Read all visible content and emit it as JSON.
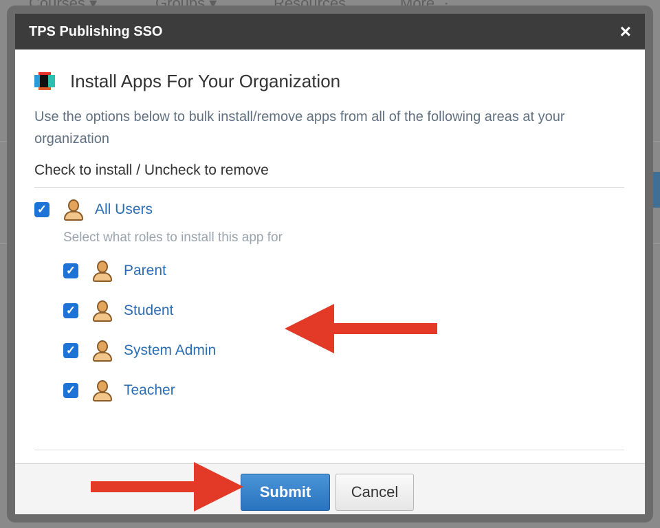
{
  "background": {
    "nav_items": [
      "Courses ▾",
      "Groups ▾",
      "Resources",
      "More ⋮"
    ]
  },
  "dialog": {
    "title": "TPS Publishing SSO",
    "close_glyph": "×",
    "heading": "Install Apps For Your Organization",
    "description": "Use the options below to bulk install/remove apps from all of the following areas at your organization",
    "check_instruction": "Check to install / Uncheck to remove",
    "all_users": {
      "label": "All Users",
      "checked": true
    },
    "roles_hint": "Select what roles to install this app for",
    "roles": [
      {
        "label": "Parent",
        "checked": true
      },
      {
        "label": "Student",
        "checked": true
      },
      {
        "label": "System Admin",
        "checked": true
      },
      {
        "label": "Teacher",
        "checked": true
      }
    ],
    "buttons": {
      "submit": "Submit",
      "cancel": "Cancel"
    }
  },
  "colors": {
    "title_bar": "#3c3c3c",
    "link": "#2a6db5",
    "checkbox": "#1e73d6",
    "submit": "#2a73bf",
    "annotation_arrow": "#e23a26"
  },
  "icons": [
    "close-icon",
    "app-logo-icon",
    "user-icon",
    "checkbox-checked-icon",
    "arrow-annotation"
  ]
}
